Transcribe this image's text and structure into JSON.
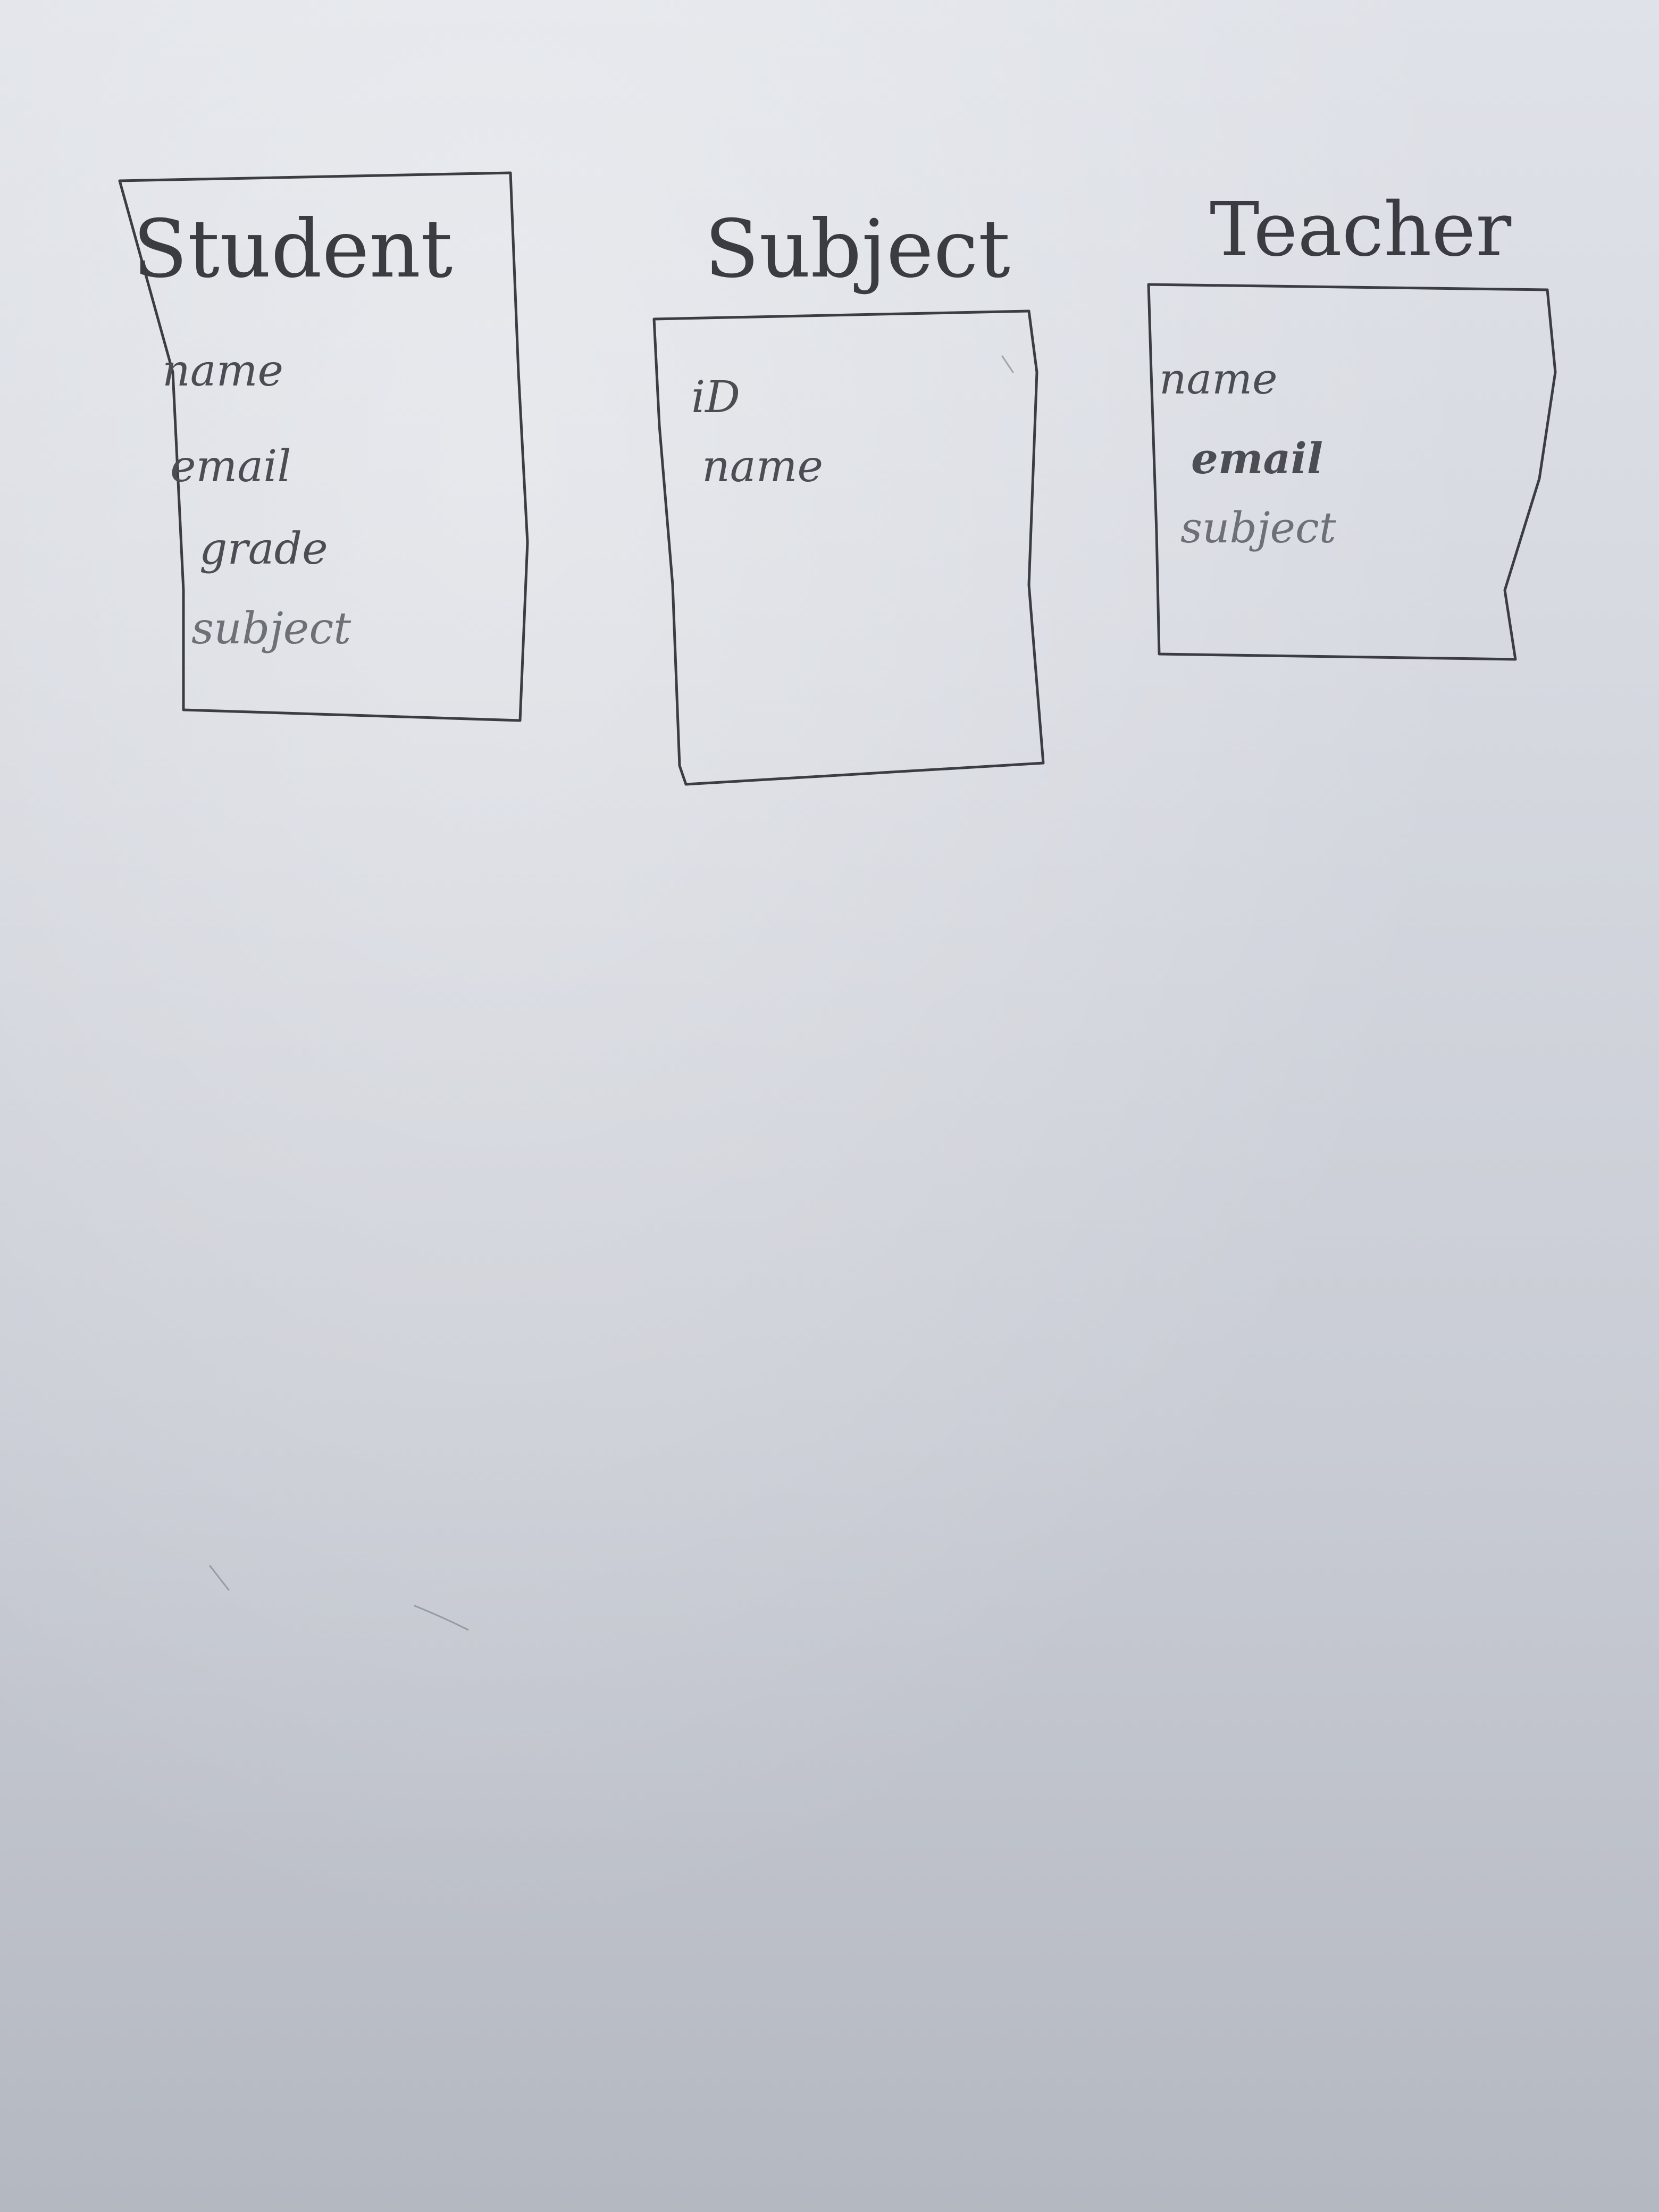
{
  "diagram": {
    "entities": [
      {
        "title": "Student",
        "attributes": [
          "name",
          "email",
          "grade",
          "subject"
        ]
      },
      {
        "title": "Subject",
        "attributes": [
          "iD",
          "name"
        ]
      },
      {
        "title": "Teacher",
        "attributes": [
          "name",
          "email",
          "subject"
        ]
      }
    ]
  },
  "colors": {
    "paper": "#d6d9e0",
    "ink": "#3b3d42"
  }
}
